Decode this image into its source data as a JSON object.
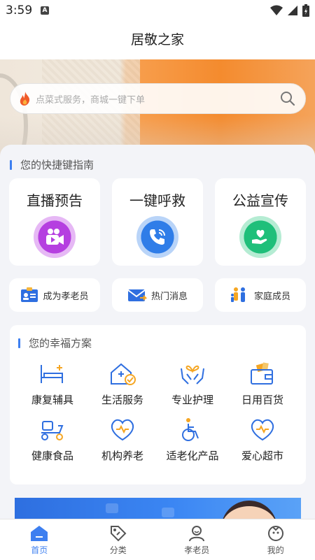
{
  "status_bar": {
    "time": "3:59",
    "notification": "A"
  },
  "header": {
    "title": "居敬之家"
  },
  "search": {
    "placeholder": "点菜式服务，商城一键下单"
  },
  "shortcuts": {
    "title": "您的快捷键指南",
    "big": [
      {
        "label": "直播预告",
        "icon": "live-video-icon",
        "color": "#b53fe0"
      },
      {
        "label": "一键呼救",
        "icon": "phone-call-icon",
        "color": "#2f7de8"
      },
      {
        "label": "公益宣传",
        "icon": "heart-hand-icon",
        "color": "#1fbf7a"
      }
    ],
    "small": [
      {
        "label": "成为孝老员",
        "icon": "id-card-icon"
      },
      {
        "label": "热门消息",
        "icon": "mail-icon"
      },
      {
        "label": "家庭成员",
        "icon": "family-icon"
      }
    ]
  },
  "plan": {
    "title": "您的幸福方案",
    "items": [
      {
        "label": "康复辅具",
        "icon": "bed-icon"
      },
      {
        "label": "生活服务",
        "icon": "home-service-icon"
      },
      {
        "label": "专业护理",
        "icon": "care-hands-icon"
      },
      {
        "label": "日用百货",
        "icon": "wallet-icon"
      },
      {
        "label": "健康食品",
        "icon": "delivery-scooter-icon"
      },
      {
        "label": "机构养老",
        "icon": "heart-pulse-icon"
      },
      {
        "label": "适老化产品",
        "icon": "wheelchair-icon"
      },
      {
        "label": "爱心超市",
        "icon": "heart-pulse-icon"
      }
    ]
  },
  "tabs": [
    {
      "label": "首页",
      "icon": "home-icon",
      "active": true
    },
    {
      "label": "分类",
      "icon": "tag-icon",
      "active": false
    },
    {
      "label": "孝老员",
      "icon": "user-icon",
      "active": false
    },
    {
      "label": "我的",
      "icon": "profile-face-icon",
      "active": false
    }
  ],
  "colors": {
    "accent": "#3d7ff0",
    "background": "#f3f4f8"
  }
}
